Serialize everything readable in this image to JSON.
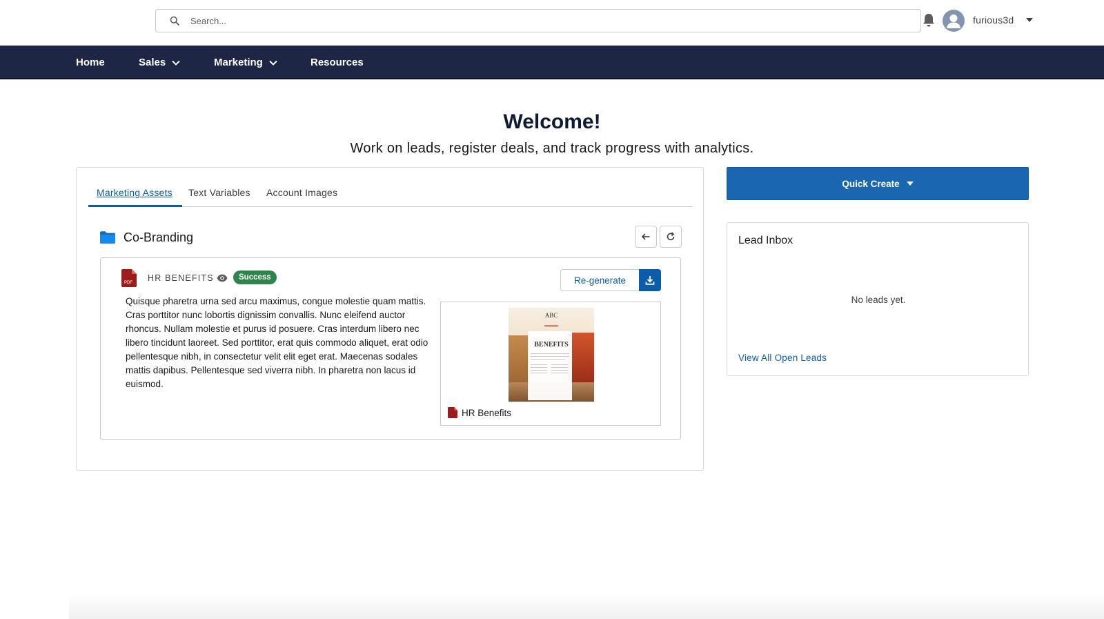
{
  "search": {
    "placeholder": "Search..."
  },
  "user": {
    "name": "furious3d"
  },
  "nav": {
    "items": [
      {
        "label": "Home"
      },
      {
        "label": "Sales"
      },
      {
        "label": "Marketing"
      },
      {
        "label": "Resources"
      }
    ]
  },
  "welcome": {
    "title": "Welcome!",
    "subtitle": "Work on leads, register deals, and track progress with analytics."
  },
  "tabs": [
    {
      "label": "Marketing Assets",
      "active": true
    },
    {
      "label": "Text Variables",
      "active": false
    },
    {
      "label": "Account Images",
      "active": false
    }
  ],
  "folder": {
    "name": "Co-Branding"
  },
  "asset": {
    "title": "HR BENEFITS",
    "status": "Success",
    "regenerate_label": "Re-generate",
    "description": "Quisque pharetra urna sed arcu maximus, congue molestie quam mattis. Cras porttitor nunc lobortis dignissim convallis. Nunc eleifend auctor rhoncus. Nullam molestie et purus id posuere. Cras interdum libero nec libero tincidunt laoreet. Sed porttitor, erat quis commodo aliquet, erat odio pellentesque nibh, in consectetur velit elit eget erat. Maecenas sodales mattis dapibus. Pellentesque sed viverra nibh. In pharetra non lacus id euismod.",
    "file_label": "HR Benefits",
    "thumb": {
      "logo": "ABC",
      "doc_title": "BENEFITS"
    }
  },
  "quick_create": {
    "label": "Quick Create"
  },
  "lead_inbox": {
    "title": "Lead Inbox",
    "empty_text": "No leads yet.",
    "link_label": "View All Open Leads"
  },
  "colors": {
    "nav_bg": "#1d2644",
    "accent": "#0b5cab",
    "success": "#2e844a",
    "pdf_red": "#9c1c1c",
    "folder_blue": "#1589ee"
  }
}
